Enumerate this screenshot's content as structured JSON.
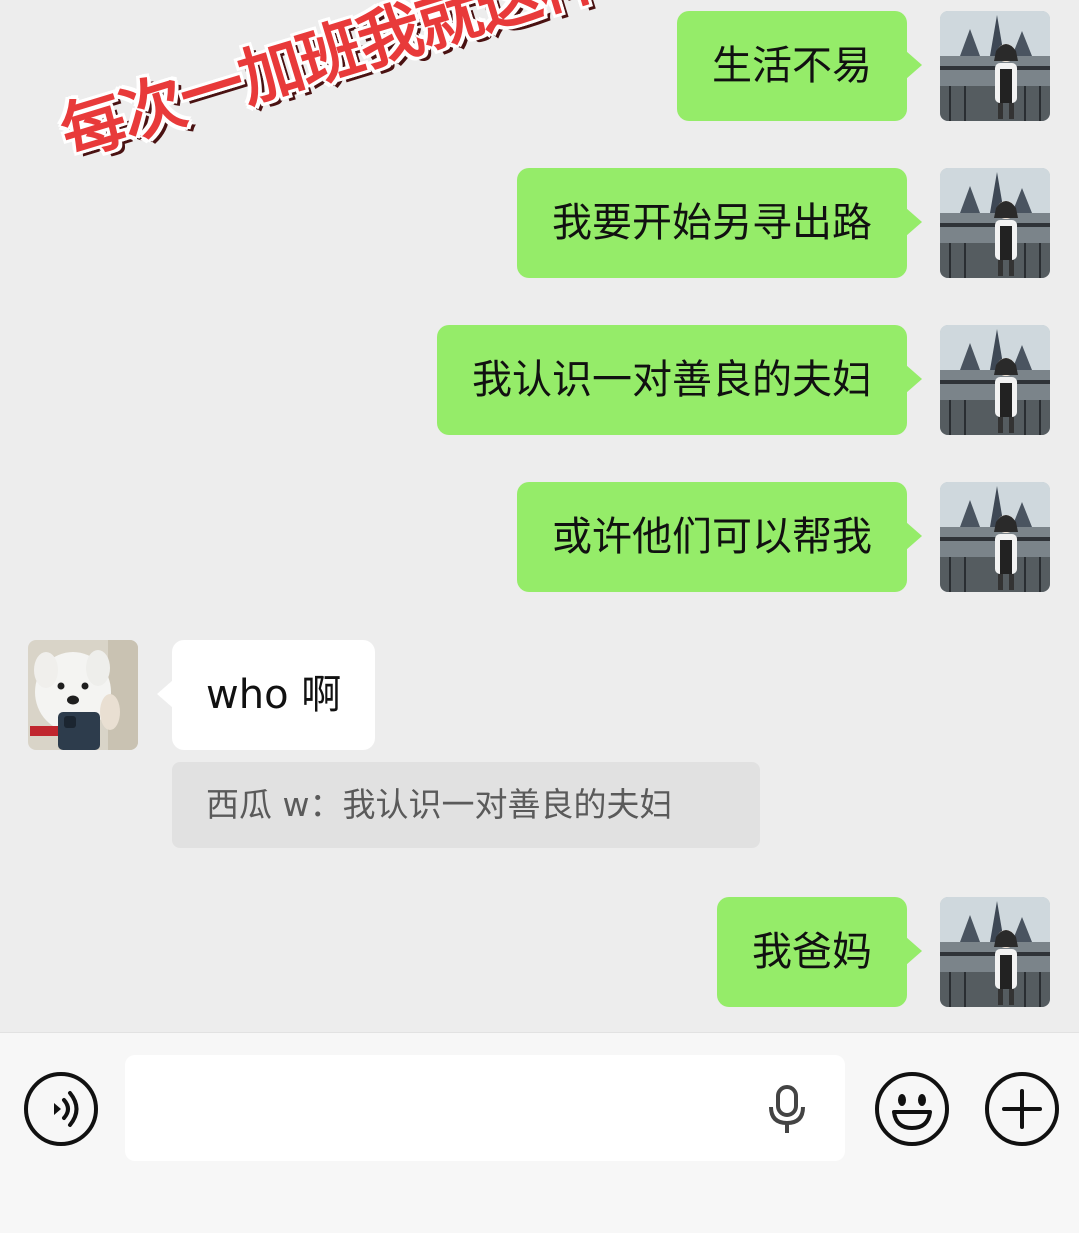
{
  "overlay_caption": "每次一加班我就这样",
  "messages": [
    {
      "side": "right",
      "text": "生活不易"
    },
    {
      "side": "right",
      "text": "我要开始另寻出路"
    },
    {
      "side": "right",
      "text": "我认识一对善良的夫妇"
    },
    {
      "side": "right",
      "text": "或许他们可以帮我"
    },
    {
      "side": "left",
      "text": "who 啊"
    },
    {
      "side": "right",
      "text": "我爸妈"
    }
  ],
  "quote": {
    "text": "西瓜 w：我认识一对善良的夫妇"
  },
  "input_bar": {
    "value": "",
    "icons": [
      "voice-mode-icon",
      "microphone-icon",
      "emoji-icon",
      "plus-icon"
    ]
  },
  "colors": {
    "background": "#ededed",
    "sent_bubble": "#95ec69",
    "received_bubble": "#ffffff",
    "caption": "#e83a3a"
  }
}
